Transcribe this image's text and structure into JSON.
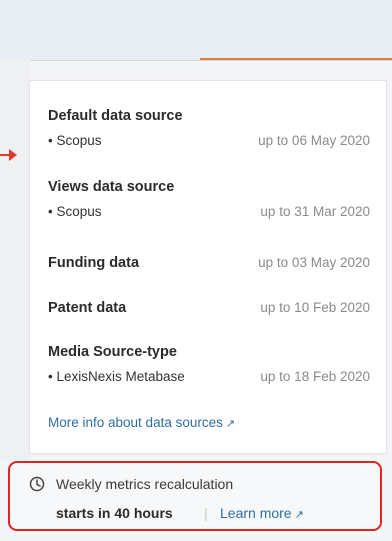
{
  "panel": {
    "default_source": {
      "label": "Default data source",
      "items": [
        {
          "name": "• Scopus",
          "date": "up to 06 May 2020"
        }
      ]
    },
    "views_source": {
      "label": "Views data source",
      "items": [
        {
          "name": "• Scopus",
          "date": "up to 31 Mar 2020"
        }
      ]
    },
    "funding": {
      "label": "Funding data",
      "date": "up to 03 May 2020"
    },
    "patent": {
      "label": "Patent data",
      "date": "up to 10 Feb 2020"
    },
    "media": {
      "label": "Media Source-type",
      "items": [
        {
          "name": "• LexisNexis Metabase",
          "date": "up to 18 Feb 2020"
        }
      ]
    },
    "more_info_link": "More info about data sources",
    "external_arrow": "↗"
  },
  "footer": {
    "icon": "clock-icon",
    "title": "Weekly metrics recalculation",
    "status": "starts in 40 hours",
    "separator": "|",
    "learn_more": "Learn more",
    "external_arrow": "↗"
  },
  "colors": {
    "highlight_border": "#df2424",
    "link": "#2f6f9f",
    "accent_line": "#e27b3d"
  }
}
